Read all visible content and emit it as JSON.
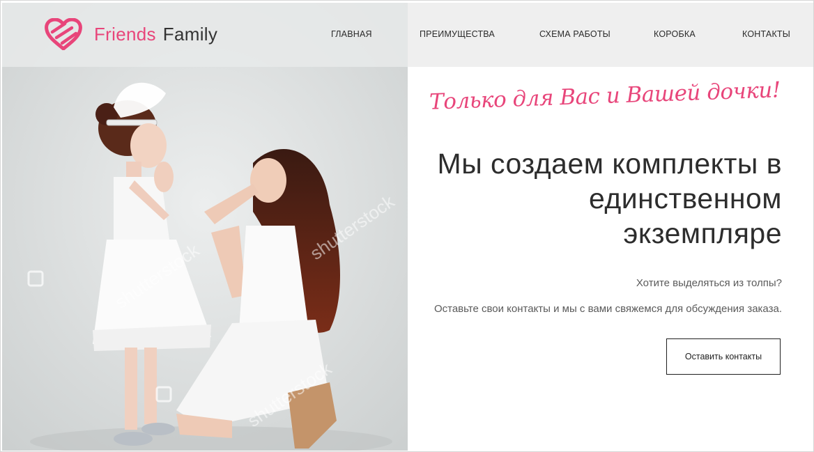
{
  "brand": {
    "name_part1": "Friends",
    "name_part2": "Family",
    "accent_color": "#e8457a",
    "logo_icon": "heart-icon"
  },
  "nav": {
    "items": [
      {
        "label": "ГЛАВНАЯ"
      },
      {
        "label": "ПРЕИМУЩЕСТВА"
      },
      {
        "label": "СХЕМА РАБОТЫ"
      },
      {
        "label": "КОРОБКА"
      },
      {
        "label": "КОНТАКТЫ"
      }
    ]
  },
  "hero": {
    "tagline": "Только для Вас и Вашей дочки!",
    "headline": [
      "Мы создаем комплекты в",
      "единственном",
      "экземпляре"
    ],
    "question": "Хотите выделяться из толпы?",
    "invite": "Оставьте свои контакты и мы с вами свяжемся для обсуждения заказа.",
    "cta_label": "Оставить контакты"
  },
  "photo": {
    "watermark": "shutterstock"
  }
}
